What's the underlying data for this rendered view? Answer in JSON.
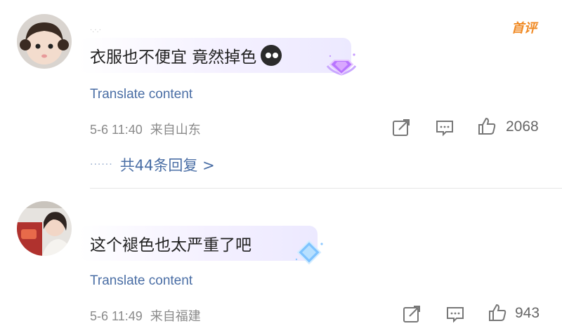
{
  "comments": [
    {
      "username": "·.·.·",
      "text": "衣服也不便宜 竟然掉色",
      "emoji_icon": "crying-face-emoji",
      "badge_icon": "purple-diamond-badge-icon",
      "top_tag": "首评",
      "translate_label": "Translate content",
      "timestamp": "5-6 11:40",
      "location": "来自山东",
      "like_count": "2068",
      "replies_label": "共44条回复 >",
      "replies_dots": "······"
    },
    {
      "text": "这个褪色也太严重了吧",
      "badge_icon": "blue-diamond-badge-icon",
      "translate_label": "Translate content",
      "timestamp": "5-6 11:49",
      "location": "来自福建",
      "like_count": "943"
    }
  ],
  "colors": {
    "link": "#4a6ea5",
    "meta": "#8a8a8a",
    "top_tag": "#f08a24"
  }
}
